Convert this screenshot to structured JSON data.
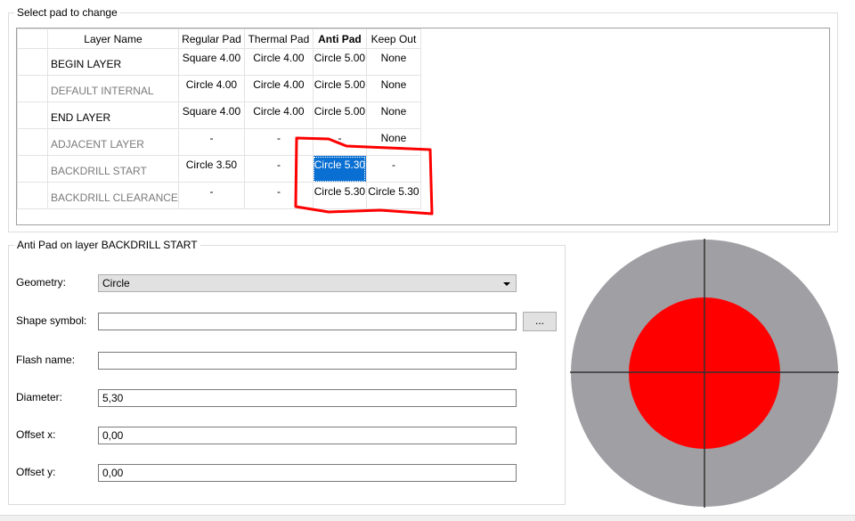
{
  "select_group": {
    "title": "Select pad to change"
  },
  "table": {
    "columns": [
      "Layer Name",
      "Regular Pad",
      "Thermal Pad",
      "Anti Pad",
      "Keep Out"
    ],
    "rows": [
      {
        "layer": "BEGIN LAYER",
        "regular": "Square 4.00",
        "thermal": "Circle 4.00",
        "anti": "Circle 5.00",
        "keepout": "None"
      },
      {
        "layer": "DEFAULT INTERNAL",
        "regular": "Circle 4.00",
        "thermal": "Circle 4.00",
        "anti": "Circle 5.00",
        "keepout": "None"
      },
      {
        "layer": "END LAYER",
        "regular": "Square 4.00",
        "thermal": "Circle 4.00",
        "anti": "Circle 5.00",
        "keepout": "None"
      },
      {
        "layer": "ADJACENT LAYER",
        "regular": "-",
        "thermal": "-",
        "anti": "-",
        "keepout": "None"
      },
      {
        "layer": "BACKDRILL START",
        "regular": "Circle 3.50",
        "thermal": "-",
        "anti": "Circle 5.30",
        "keepout": "-"
      },
      {
        "layer": "BACKDRILL CLEARANCE",
        "regular": "-",
        "thermal": "-",
        "anti": "Circle 5.30",
        "keepout": "Circle 5.30"
      }
    ]
  },
  "detail_group": {
    "title": "Anti Pad on layer BACKDRILL START",
    "geometry_label": "Geometry:",
    "geometry_value": "Circle",
    "shape_symbol_label": "Shape symbol:",
    "shape_symbol_value": "",
    "browse_label": "...",
    "flash_name_label": "Flash name:",
    "flash_name_value": "",
    "diameter_label": "Diameter:",
    "diameter_value": "5,30",
    "offset_x_label": "Offset x:",
    "offset_x_value": "0,00",
    "offset_y_label": "Offset y:",
    "offset_y_value": "0,00"
  },
  "preview": {
    "outer_color": "#a09fa4",
    "inner_color": "#ff0000",
    "crosshair_color": "#333333"
  },
  "annotation_color": "#ff0000",
  "selection_color": "#0a6fd2"
}
